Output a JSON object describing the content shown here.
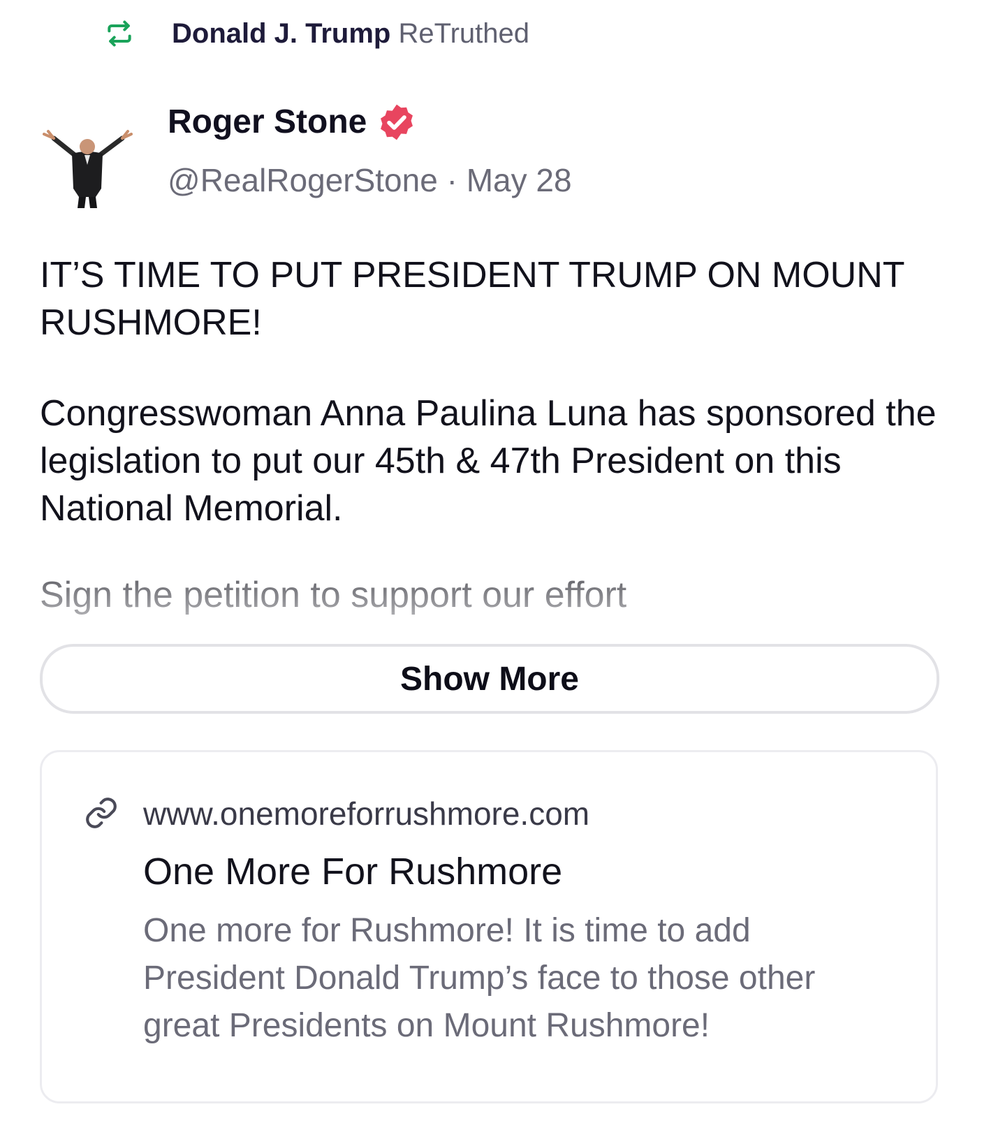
{
  "retruth": {
    "name": "Donald J. Trump",
    "label": "ReTruthed",
    "icon": "retruth-icon",
    "icon_color": "#1aa35a"
  },
  "author": {
    "name": "Roger Stone",
    "verified_icon": "verified-badge-icon",
    "verified_color": "#e8455f",
    "handle": "@RealRogerStone",
    "separator": "·",
    "date": "May 28"
  },
  "post": {
    "paragraph_1": "IT’S TIME TO PUT PRESIDENT TRUMP ON MOUNT RUSHMORE!",
    "paragraph_2": "Congresswoman Anna Paulina Luna has sponsored the legislation to put our 45th & 47th President on this National Memorial.",
    "paragraph_3": "Sign the petition to support our effort"
  },
  "show_more_label": "Show More",
  "link_card": {
    "icon": "link-icon",
    "url": "www.onemoreforrushmore.com",
    "title": "One More For Rushmore",
    "description": "One more for Rushmore! It is time to add President Donald Trump’s face to those other great Presidents on Mount Rushmore!"
  }
}
